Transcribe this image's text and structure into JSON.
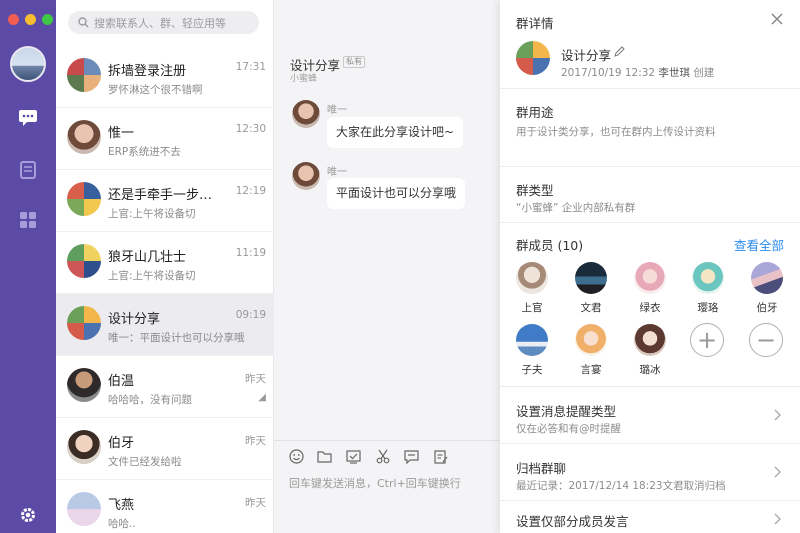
{
  "search": {
    "placeholder": "搜索联系人、群、轻应用等"
  },
  "nav": {
    "icons": [
      "message-icon",
      "notebook-icon",
      "apps-icon",
      "settings-icon"
    ]
  },
  "conversations": [
    {
      "name": "拆墙登录注册",
      "preview": "罗怀淋这个很不错啊",
      "time": "17:31"
    },
    {
      "name": "惟一",
      "preview": "ERP系统进不去",
      "time": "12:30"
    },
    {
      "name": "还是手牵手一步…",
      "preview": "上官:上午将设备切",
      "time": "12:19"
    },
    {
      "name": "狼牙山几壮士",
      "preview": "上官:上午将设备切",
      "time": "11:19"
    },
    {
      "name": "设计分享",
      "preview": "唯一：平面设计也可以分享哦",
      "time": "09:19"
    },
    {
      "name": "伯温",
      "preview": "哈哈哈，没有问题",
      "time": "昨天"
    },
    {
      "name": "伯牙",
      "preview": "文件已经发给啦",
      "time": "昨天"
    },
    {
      "name": "飞燕",
      "preview": "哈哈..",
      "time": "昨天"
    }
  ],
  "chat": {
    "title": "设计分享",
    "tag": "私有",
    "subtitle": "小蜜蜂",
    "messages": [
      {
        "sender": "唯一",
        "text": "大家在此分享设计吧~"
      },
      {
        "sender": "唯一",
        "text": "平面设计也可以分享哦"
      }
    ],
    "input_hint": "回车键发送消息，Ctrl+回车键换行"
  },
  "detail": {
    "header": "群详情",
    "group_name": "设计分享",
    "created_at": "2017/10/19 12:32",
    "creator": "李世琪",
    "created_suffix": "创建",
    "purpose_title": "群用途",
    "purpose_text": "用于设计类分享，也可在群内上传设计资料",
    "type_title": "群类型",
    "type_text": "“小蜜蜂” 企业内部私有群",
    "members_title": "群成员 (10)",
    "view_all": "查看全部",
    "members": [
      "上官",
      "文君",
      "绿衣",
      "璎珞",
      "伯牙",
      "子夫",
      "言宴",
      "璐冰"
    ],
    "rows": [
      {
        "title": "设置消息提醒类型",
        "sub": "仅在必答和有@时提醒"
      },
      {
        "title": "归档群聊",
        "sub": "最近记录：2017/12/14 18:23文君取消归档"
      },
      {
        "title": "设置仅部分成员发言",
        "sub": ""
      }
    ]
  },
  "colors": {
    "sidebar": "#5b4aa6",
    "accent": "#2d8cf0",
    "active_row": "#ebebf0"
  }
}
